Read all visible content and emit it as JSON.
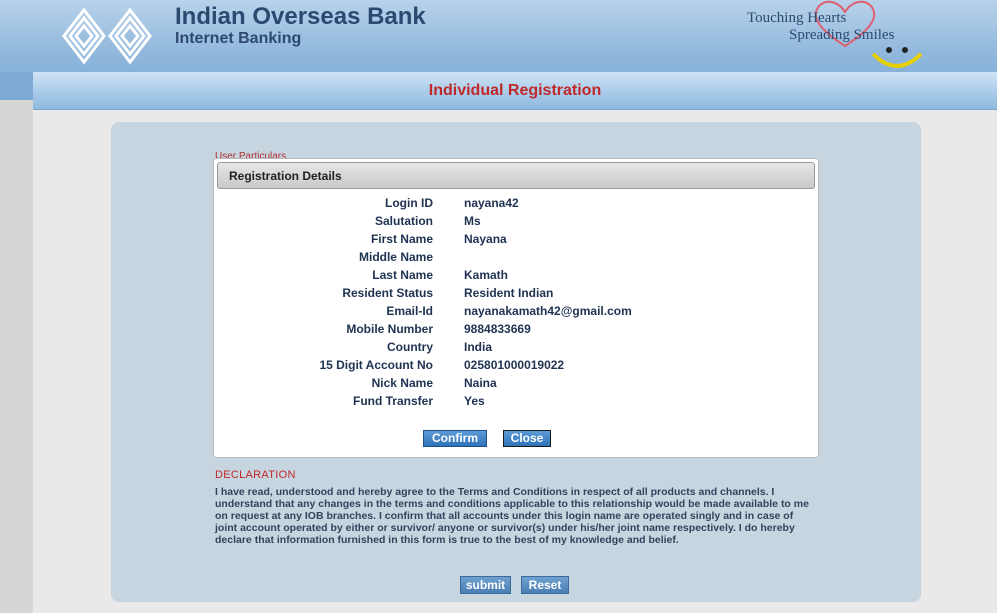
{
  "header": {
    "bank_name": "Indian Overseas Bank",
    "bank_sub": "Internet Banking",
    "tagline_line1": "Touching Hearts",
    "tagline_line2": "Spreading Smiles"
  },
  "page": {
    "title": "Individual Registration",
    "section_label": "User Particulars"
  },
  "modal": {
    "title": "Registration Details",
    "rows": [
      {
        "label": "Login ID",
        "value": "nayana42"
      },
      {
        "label": "Salutation",
        "value": "Ms"
      },
      {
        "label": "First Name",
        "value": "Nayana"
      },
      {
        "label": "Middle Name",
        "value": ""
      },
      {
        "label": "Last Name",
        "value": "Kamath"
      },
      {
        "label": "Resident Status",
        "value": "Resident Indian"
      },
      {
        "label": "Email-Id",
        "value": "nayanakamath42@gmail.com"
      },
      {
        "label": "Mobile Number",
        "value": "9884833669"
      },
      {
        "label": "Country",
        "value": "India"
      },
      {
        "label": "15 Digit Account No",
        "value": "025801000019022"
      },
      {
        "label": "Nick Name",
        "value": "Naina"
      },
      {
        "label": "Fund Transfer",
        "value": "Yes"
      }
    ],
    "confirm_label": "Confirm",
    "close_label": "Close"
  },
  "declaration": {
    "title": "DECLARATION",
    "text": "I have read, understood and hereby agree to the Terms and Conditions in respect of all products and channels. I understand that any changes in the terms and conditions applicable to this relationship would be made available to me on request at any IOB branches. I confirm that all accounts under this login name are operated singly and in case of joint account operated by either or survivor/ anyone or survivor(s) under his/her joint name respectively. I do hereby declare that information furnished in this form is true to the best of my knowledge and belief."
  },
  "actions": {
    "submit_label": "submit",
    "reset_label": "Reset"
  },
  "colors": {
    "brand_navy": "#2c4970",
    "title_red": "#c0282a",
    "button_blue": "#2f73b8"
  }
}
